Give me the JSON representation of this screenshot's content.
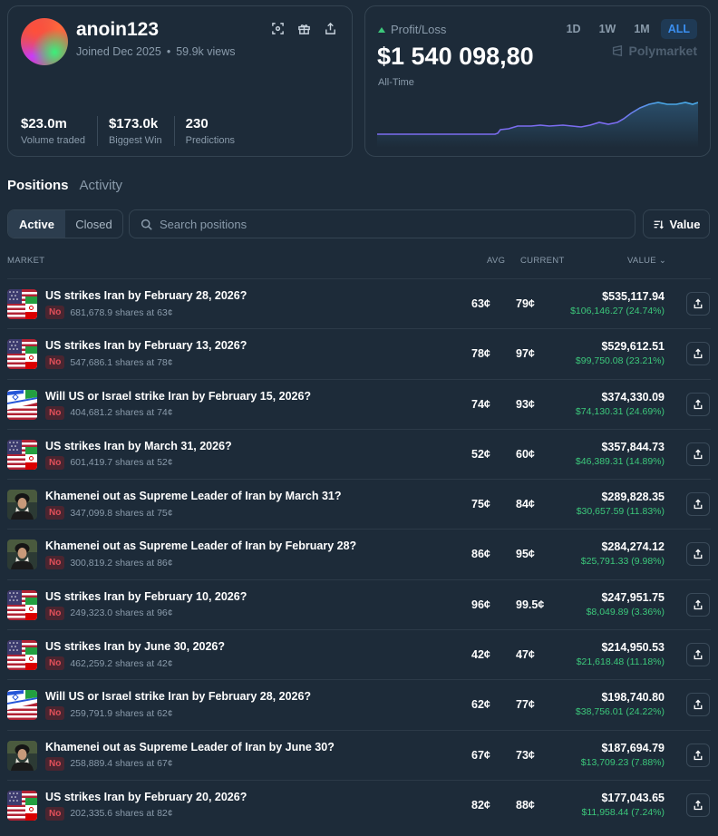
{
  "profile": {
    "username": "anoin123",
    "joined": "Joined Dec 2025",
    "views": "59.9k views",
    "icons": [
      "scan-icon",
      "gift-icon",
      "share-icon"
    ],
    "stats": [
      {
        "value": "$23.0m",
        "label": "Volume traded"
      },
      {
        "value": "$173.0k",
        "label": "Biggest Win"
      },
      {
        "value": "230",
        "label": "Predictions"
      }
    ]
  },
  "pnl": {
    "label": "Profit/Loss",
    "value": "$1 540 098,80",
    "period": "All-Time",
    "ranges": [
      "1D",
      "1W",
      "1M",
      "ALL"
    ],
    "active_range": "ALL",
    "brand": "Polymarket",
    "colors": {
      "line": "#7b6cf0",
      "line_end": "#4aa8e8",
      "up": "#3cc87b"
    }
  },
  "tabs": {
    "positions": "Positions",
    "activity": "Activity"
  },
  "filter": {
    "active": "Active",
    "closed": "Closed"
  },
  "search": {
    "placeholder": "Search positions"
  },
  "sort": {
    "label": "Value"
  },
  "table": {
    "headers": {
      "market": "MARKET",
      "avg": "AVG",
      "current": "CURRENT",
      "value": "VALUE"
    },
    "rows": [
      {
        "icon": "us-iran-flags",
        "title": "US strikes Iran by February 28, 2026?",
        "outcome": "No",
        "shares": "681,678.9 shares at 63¢",
        "avg": "63¢",
        "current": "79¢",
        "value": "$535,117.94",
        "gain": "$106,146.27 (24.74%)"
      },
      {
        "icon": "us-iran-flags",
        "title": "US strikes Iran by February 13, 2026?",
        "outcome": "No",
        "shares": "547,686.1 shares at 78¢",
        "avg": "78¢",
        "current": "97¢",
        "value": "$529,612.51",
        "gain": "$99,750.08 (23.21%)"
      },
      {
        "icon": "israel-us-iran-flags",
        "title": "Will US or Israel strike Iran by February 15, 2026?",
        "outcome": "No",
        "shares": "404,681.2 shares at 74¢",
        "avg": "74¢",
        "current": "93¢",
        "value": "$374,330.09",
        "gain": "$74,130.31 (24.69%)"
      },
      {
        "icon": "us-iran-flags",
        "title": "US strikes Iran by March 31, 2026?",
        "outcome": "No",
        "shares": "601,419.7 shares at 52¢",
        "avg": "52¢",
        "current": "60¢",
        "value": "$357,844.73",
        "gain": "$46,389.31 (14.89%)"
      },
      {
        "icon": "leader-portrait",
        "title": "Khamenei out as Supreme Leader of Iran by March 31?",
        "outcome": "No",
        "shares": "347,099.8 shares at 75¢",
        "avg": "75¢",
        "current": "84¢",
        "value": "$289,828.35",
        "gain": "$30,657.59 (11.83%)"
      },
      {
        "icon": "leader-portrait",
        "title": "Khamenei out as Supreme Leader of Iran by February 28?",
        "outcome": "No",
        "shares": "300,819.2 shares at 86¢",
        "avg": "86¢",
        "current": "95¢",
        "value": "$284,274.12",
        "gain": "$25,791.33 (9.98%)"
      },
      {
        "icon": "us-iran-flags",
        "title": "US strikes Iran by February 10, 2026?",
        "outcome": "No",
        "shares": "249,323.0 shares at 96¢",
        "avg": "96¢",
        "current": "99.5¢",
        "value": "$247,951.75",
        "gain": "$8,049.89 (3.36%)"
      },
      {
        "icon": "us-iran-flags",
        "title": "US strikes Iran by June 30, 2026?",
        "outcome": "No",
        "shares": "462,259.2 shares at 42¢",
        "avg": "42¢",
        "current": "47¢",
        "value": "$214,950.53",
        "gain": "$21,618.48 (11.18%)"
      },
      {
        "icon": "israel-us-iran-flags",
        "title": "Will US or Israel strike Iran by February 28, 2026?",
        "outcome": "No",
        "shares": "259,791.9 shares at 62¢",
        "avg": "62¢",
        "current": "77¢",
        "value": "$198,740.80",
        "gain": "$38,756.01 (24.22%)"
      },
      {
        "icon": "leader-portrait",
        "title": "Khamenei out as Supreme Leader of Iran by June 30?",
        "outcome": "No",
        "shares": "258,889.4 shares at 67¢",
        "avg": "67¢",
        "current": "73¢",
        "value": "$187,694.79",
        "gain": "$13,709.23 (7.88%)"
      },
      {
        "icon": "us-iran-flags",
        "title": "US strikes Iran by February 20, 2026?",
        "outcome": "No",
        "shares": "202,335.6 shares at 82¢",
        "avg": "82¢",
        "current": "88¢",
        "value": "$177,043.65",
        "gain": "$11,958.44 (7.24%)"
      }
    ]
  }
}
